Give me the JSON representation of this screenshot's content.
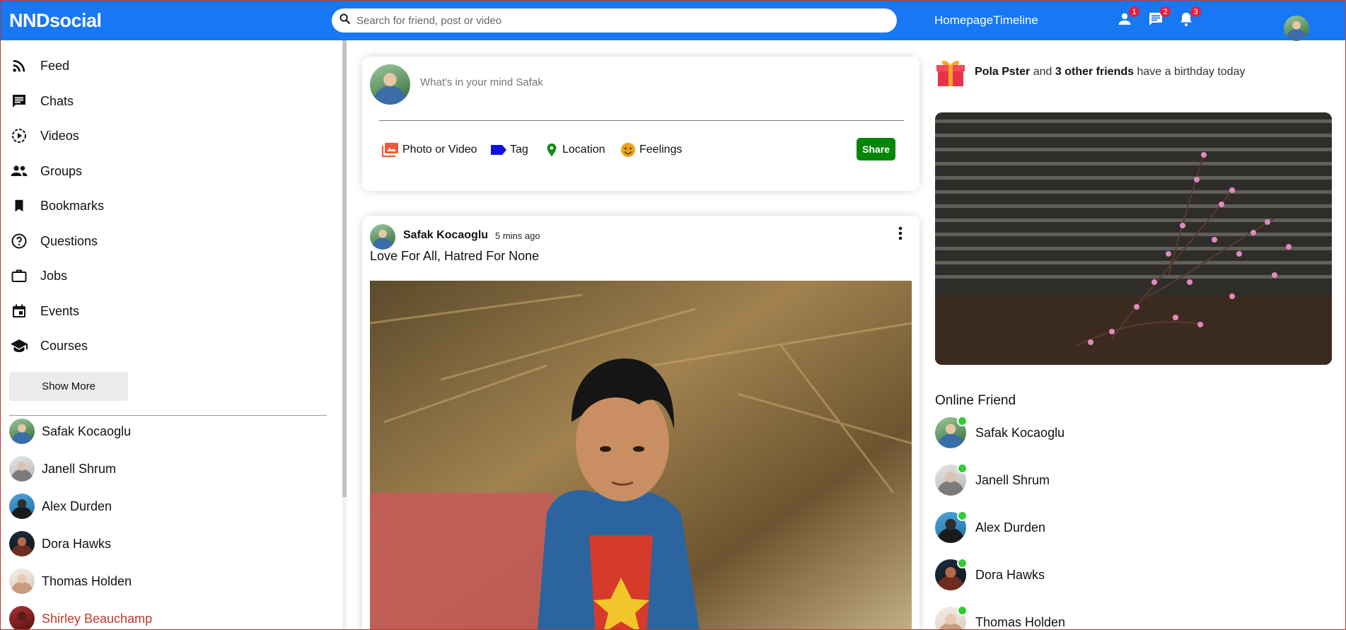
{
  "topbar": {
    "logo": "NNDsocial",
    "search_placeholder": "Search for friend, post or video",
    "links": [
      "Homepage",
      "Timeline"
    ],
    "badges": {
      "friends": "1",
      "messages": "2",
      "notifications": "3"
    }
  },
  "sidebar": {
    "items": [
      {
        "label": "Feed",
        "icon": "rss-feed-icon"
      },
      {
        "label": "Chats",
        "icon": "chat-icon"
      },
      {
        "label": "Videos",
        "icon": "play-circle-icon"
      },
      {
        "label": "Groups",
        "icon": "group-icon"
      },
      {
        "label": "Bookmarks",
        "icon": "bookmark-icon"
      },
      {
        "label": "Questions",
        "icon": "help-circle-icon"
      },
      {
        "label": "Jobs",
        "icon": "briefcase-icon"
      },
      {
        "label": "Events",
        "icon": "calendar-icon"
      },
      {
        "label": "Courses",
        "icon": "school-icon"
      }
    ],
    "show_more": "Show More",
    "friends": [
      "Safak Kocaoglu",
      "Janell Shrum",
      "Alex Durden",
      "Dora Hawks",
      "Thomas Holden",
      "Shirley Beauchamp"
    ]
  },
  "share": {
    "placeholder": "What's in your mind Safak",
    "options": [
      "Photo or Video",
      "Tag",
      "Location",
      "Feelings"
    ],
    "button": "Share"
  },
  "post": {
    "username": "Safak Kocaoglu",
    "time": "5 mins ago",
    "text": "Love For All, Hatred For None"
  },
  "rightbar": {
    "birthday": {
      "name": "Pola Pster",
      "connector": "and",
      "others": "3 other friends",
      "suffix": "have a birthday today"
    },
    "online_title": "Online Friend",
    "online": [
      "Safak Kocaoglu",
      "Janell Shrum",
      "Alex Durden",
      "Dora Hawks",
      "Thomas Holden"
    ]
  },
  "colors": {
    "brand": "#1877f2",
    "share_button": "#078507",
    "online": "#32cd32",
    "badge": "#e41e3f"
  }
}
